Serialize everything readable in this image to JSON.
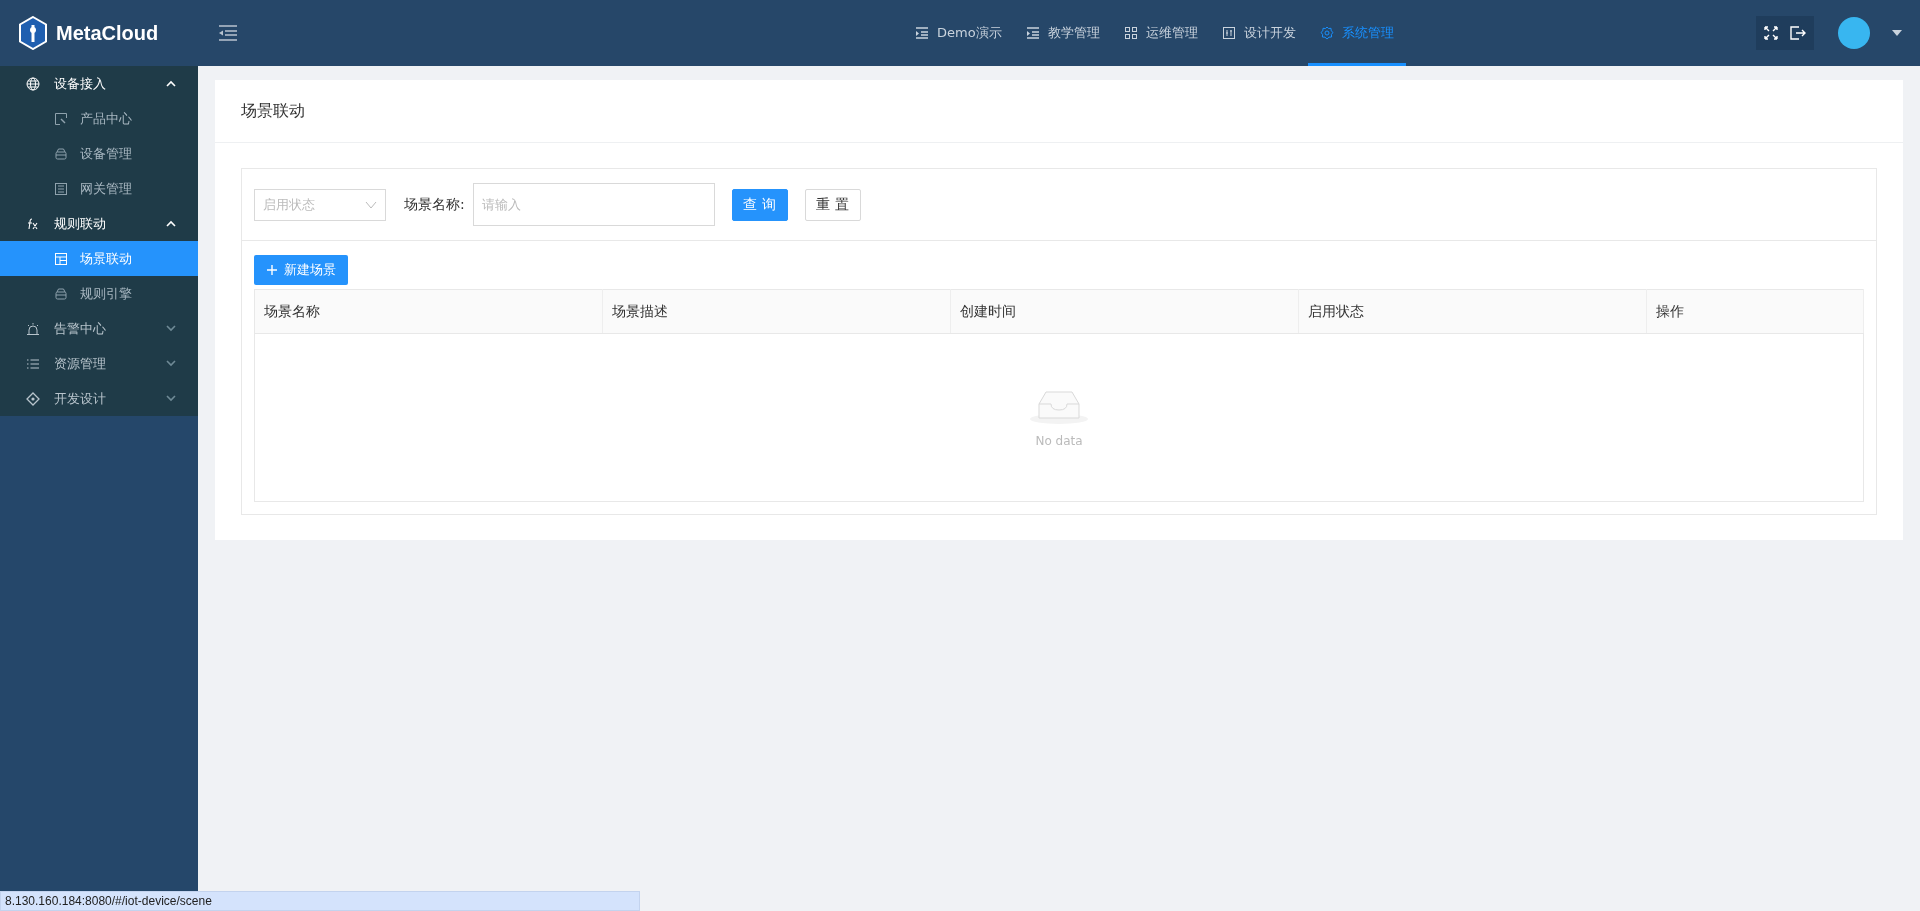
{
  "brand": {
    "name": "MetaCloud"
  },
  "top_nav": [
    {
      "label": "Demo演示",
      "kind": "indent",
      "selected": false
    },
    {
      "label": "教学管理",
      "kind": "indent",
      "selected": false
    },
    {
      "label": "运维管理",
      "kind": "grid",
      "selected": false
    },
    {
      "label": "设计开发",
      "kind": "panel",
      "selected": false
    },
    {
      "label": "系统管理",
      "kind": "gear",
      "selected": true
    }
  ],
  "sidebar": {
    "items": [
      {
        "label": "设备接入",
        "kind": "globe",
        "expanded": true,
        "children": [
          {
            "label": "产品中心",
            "kind": "product",
            "selected": false
          },
          {
            "label": "设备管理",
            "kind": "box",
            "selected": false
          },
          {
            "label": "网关管理",
            "kind": "gateway",
            "selected": false
          }
        ]
      },
      {
        "label": "规则联动",
        "kind": "fx",
        "expanded": true,
        "children": [
          {
            "label": "场景联动",
            "kind": "table",
            "selected": true
          },
          {
            "label": "规则引擎",
            "kind": "box",
            "selected": false
          }
        ]
      },
      {
        "label": "告警中心",
        "kind": "alarm",
        "expanded": false
      },
      {
        "label": "资源管理",
        "kind": "list",
        "expanded": false
      },
      {
        "label": "开发设计",
        "kind": "diamond",
        "expanded": false
      }
    ]
  },
  "page": {
    "title": "场景联动",
    "filter": {
      "status_select": {
        "placeholder": "启用状态"
      },
      "name_label": "场景名称:",
      "name_input": {
        "placeholder": "请输入"
      },
      "buttons": [
        {
          "label": "查 询",
          "kind": "primary"
        },
        {
          "label": "重 置",
          "kind": "default"
        }
      ]
    },
    "new_button": "新建场景",
    "table": {
      "columns": [
        "场景名称",
        "场景描述",
        "创建时间",
        "启用状态",
        "操作"
      ],
      "empty_text": "No data"
    }
  },
  "status_bar": {
    "url": "8.130.160.184:8080/#/iot-device/scene"
  }
}
